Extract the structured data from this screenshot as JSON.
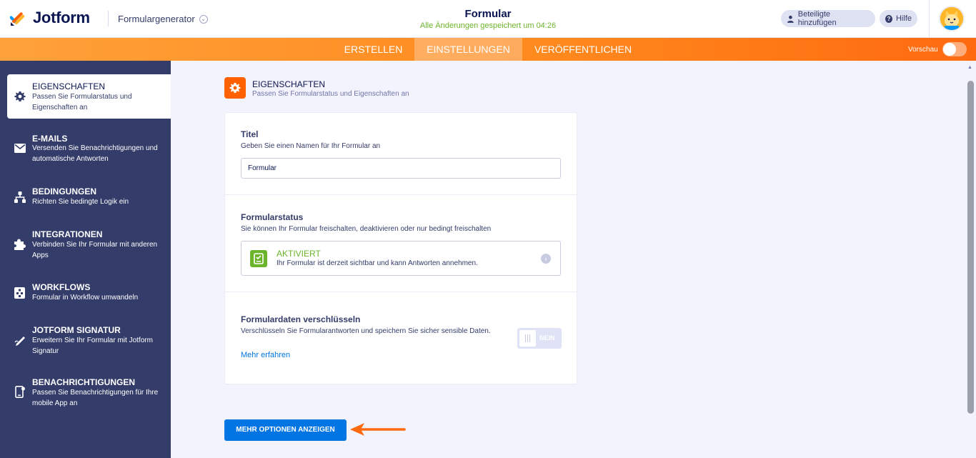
{
  "header": {
    "logo_text": "Jotform",
    "builder_label": "Formulargenerator",
    "form_title": "Formular",
    "saved_status": "Alle Änderungen gespeichert um 04:26",
    "add_participants_label": "Beteiligte hinzufügen",
    "help_label": "Hilfe"
  },
  "navbar": {
    "tabs": [
      {
        "label": "ERSTELLEN"
      },
      {
        "label": "EINSTELLUNGEN"
      },
      {
        "label": "VERÖFFENTLICHEN"
      }
    ],
    "active_tab": "EINSTELLUNGEN",
    "preview_label": "Vorschau",
    "preview_on": false
  },
  "sidebar": {
    "items": [
      {
        "title": "EIGENSCHAFTEN",
        "desc": "Passen Sie Formularstatus und Eigenschaften an",
        "icon": "gear-icon"
      },
      {
        "title": "E-MAILS",
        "desc": "Versenden Sie Benachrichtigungen und automatische Antworten",
        "icon": "mail-icon"
      },
      {
        "title": "BEDINGUNGEN",
        "desc": "Richten Sie bedingte Logik ein",
        "icon": "conditions-icon"
      },
      {
        "title": "INTEGRATIONEN",
        "desc": "Verbinden Sie Ihr Formular mit anderen Apps",
        "icon": "puzzle-icon"
      },
      {
        "title": "WORKFLOWS",
        "desc": "Formular in Workflow umwandeln",
        "icon": "workflow-icon"
      },
      {
        "title": "JOTFORM SIGNATUR",
        "desc": "Erweitern Sie Ihr Formular mit Jotform Signatur",
        "icon": "signature-icon"
      },
      {
        "title": "BENACHRICHTIGUNGEN",
        "desc": "Passen Sie Benachrichtigungen für Ihre mobile App an",
        "icon": "mobile-notification-icon"
      }
    ]
  },
  "main": {
    "section_title": "EIGENSCHAFTEN",
    "section_desc": "Passen Sie Formularstatus und Eigenschaften an",
    "title_field": {
      "label": "Titel",
      "desc": "Geben Sie einen Namen für Ihr Formular an",
      "value": "Formular"
    },
    "status_field": {
      "label": "Formularstatus",
      "desc": "Sie können Ihr Formular freischalten, deaktivieren oder nur bedingt freischalten",
      "status_title": "AKTIVIERT",
      "status_desc": "Ihr Formular ist derzeit sichtbar und kann Antworten annehmen."
    },
    "encrypt_field": {
      "label": "Formulardaten verschlüsseln",
      "desc": "Verschlüsseln Sie Formularantworten und speichern Sie sicher sensible Daten.",
      "learn_more": "Mehr erfahren",
      "toggle_label": "NEIN",
      "enabled": false
    },
    "more_options_label": "MEHR OPTIONEN ANZEIGEN"
  },
  "colors": {
    "brand_orange": "#ff6100",
    "sidebar_bg": "#343c6a",
    "status_green": "#6cb42c",
    "primary_blue": "#0075e3",
    "annotation_arrow": "#ff6a10"
  }
}
